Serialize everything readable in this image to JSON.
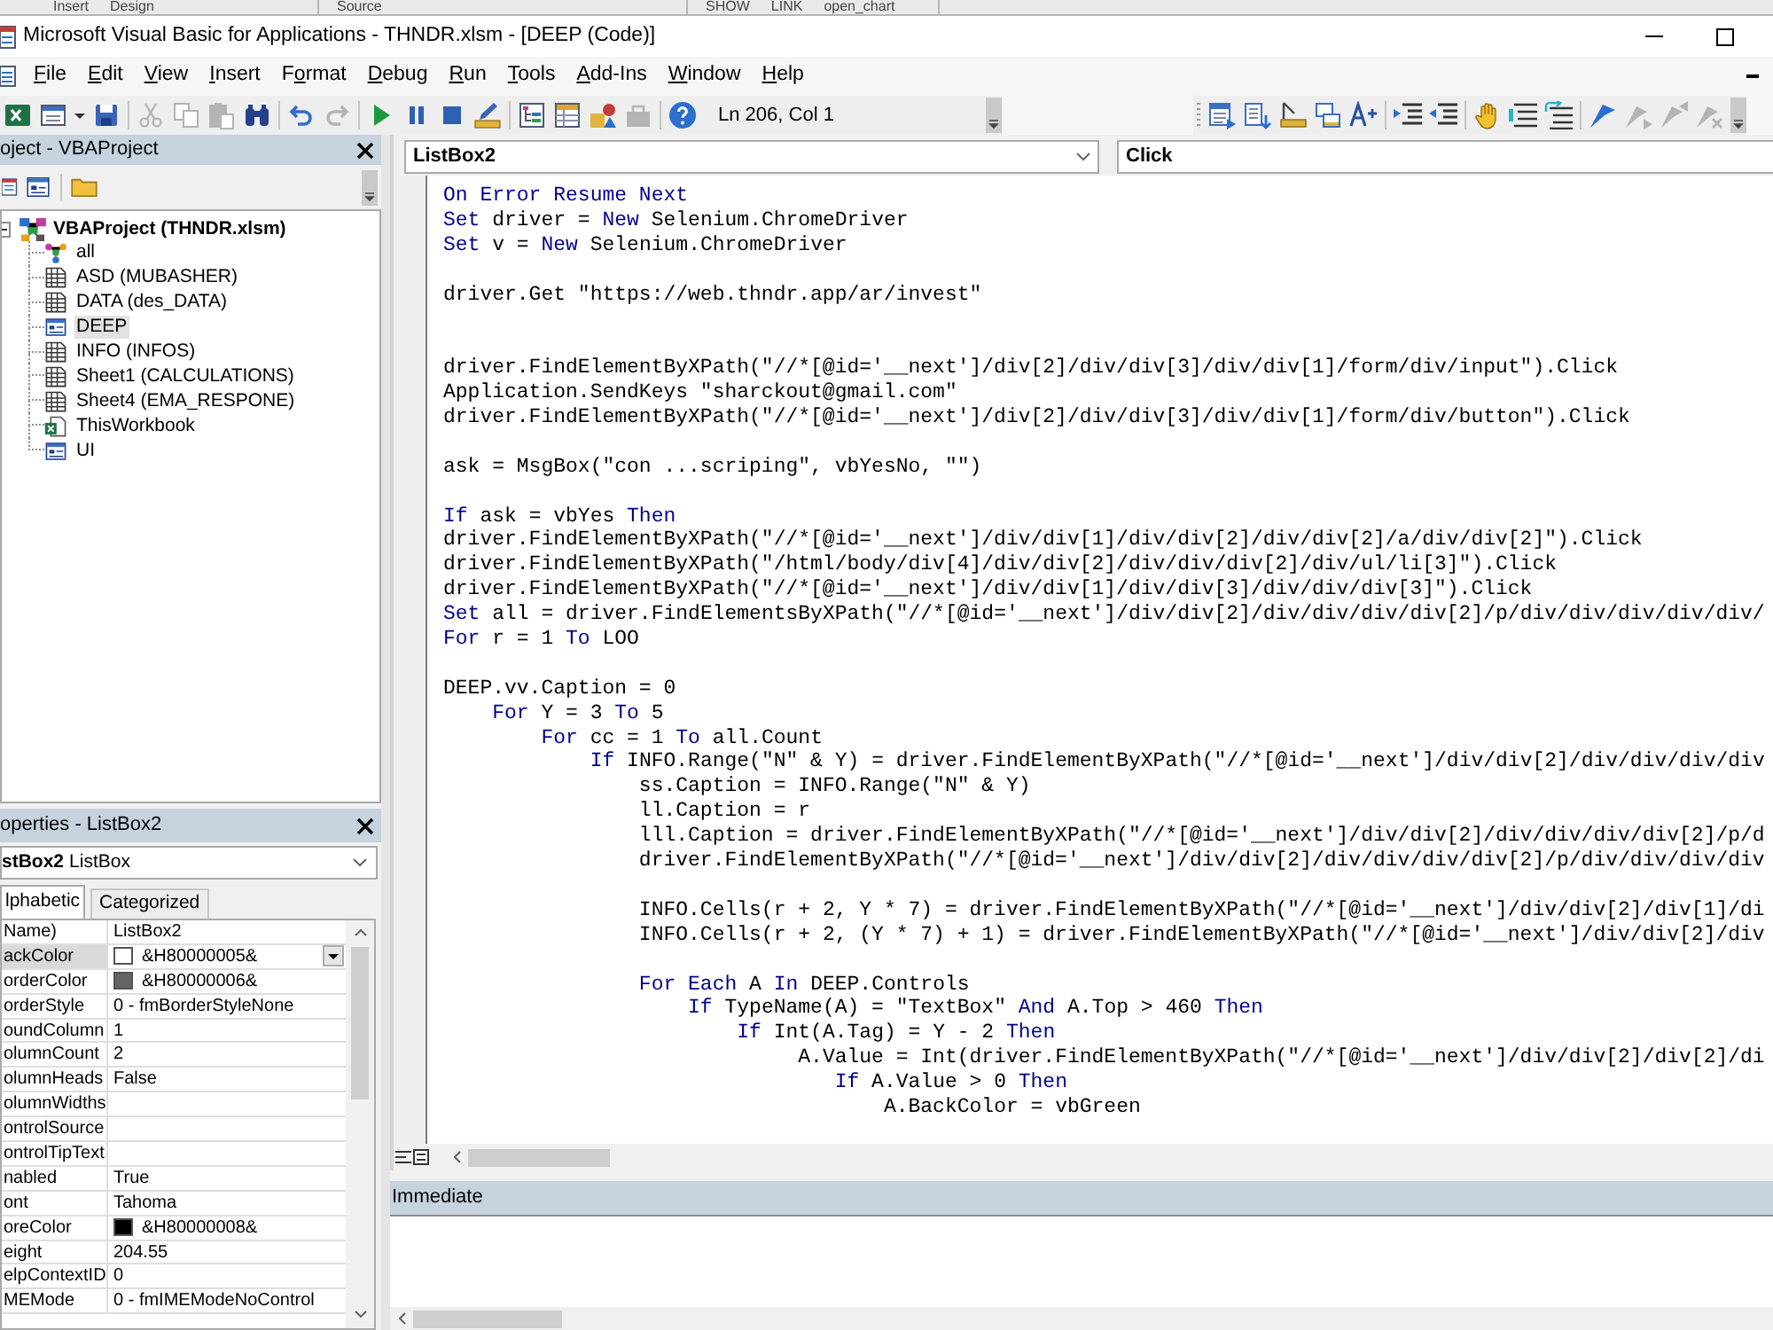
{
  "background_window": {
    "groups": [
      [
        "Insert",
        "Design"
      ],
      [
        "Source"
      ],
      [
        "SHOW",
        "LINK",
        "open_chart"
      ]
    ]
  },
  "window": {
    "title": "Microsoft Visual Basic for Applications - THNDR.xlsm - [DEEP (Code)]"
  },
  "menu": [
    {
      "parts": [
        {
          "text": "F",
          "underline": true
        },
        {
          "text": "ile",
          "underline": false
        }
      ]
    },
    {
      "parts": [
        {
          "text": "E",
          "underline": true
        },
        {
          "text": "dit",
          "underline": false
        }
      ]
    },
    {
      "parts": [
        {
          "text": "V",
          "underline": true
        },
        {
          "text": "iew",
          "underline": false
        }
      ]
    },
    {
      "parts": [
        {
          "text": "I",
          "underline": true
        },
        {
          "text": "nsert",
          "underline": false
        }
      ]
    },
    {
      "parts": [
        {
          "text": "F",
          "underline": false
        },
        {
          "text": "o",
          "underline": true
        },
        {
          "text": "rmat",
          "underline": false
        }
      ]
    },
    {
      "parts": [
        {
          "text": "D",
          "underline": true
        },
        {
          "text": "ebug",
          "underline": false
        }
      ]
    },
    {
      "parts": [
        {
          "text": "R",
          "underline": true
        },
        {
          "text": "un",
          "underline": false
        }
      ]
    },
    {
      "parts": [
        {
          "text": "T",
          "underline": true
        },
        {
          "text": "ools",
          "underline": false
        }
      ]
    },
    {
      "parts": [
        {
          "text": "A",
          "underline": true
        },
        {
          "text": "dd-Ins",
          "underline": false
        }
      ]
    },
    {
      "parts": [
        {
          "text": "W",
          "underline": true
        },
        {
          "text": "indow",
          "underline": false
        }
      ]
    },
    {
      "parts": [
        {
          "text": "H",
          "underline": true
        },
        {
          "text": "elp",
          "underline": false
        }
      ]
    }
  ],
  "standard_toolbar": {
    "groups": [
      [
        {
          "kind": "spreadsheet",
          "disabled": false
        },
        {
          "kind": "form",
          "disabled": false
        },
        {
          "kind": "dropdown",
          "disabled": false
        },
        {
          "kind": "save",
          "disabled": false
        }
      ],
      [
        {
          "kind": "cut",
          "disabled": true
        },
        {
          "kind": "copy",
          "disabled": true
        },
        {
          "kind": "paste",
          "disabled": true
        },
        {
          "kind": "find",
          "disabled": false
        }
      ],
      [
        {
          "kind": "undo",
          "disabled": false
        },
        {
          "kind": "redo",
          "disabled": true
        }
      ],
      [
        {
          "kind": "run",
          "disabled": false
        },
        {
          "kind": "pause",
          "disabled": false
        },
        {
          "kind": "stop",
          "disabled": false
        },
        {
          "kind": "design",
          "disabled": false
        }
      ],
      [
        {
          "kind": "project",
          "disabled": false
        },
        {
          "kind": "properties",
          "disabled": false
        },
        {
          "kind": "browser",
          "disabled": false
        },
        {
          "kind": "toolbox",
          "disabled": true
        }
      ],
      [
        {
          "kind": "help",
          "disabled": false
        }
      ]
    ],
    "position": "Ln 206, Col 1"
  },
  "edit_toolbar": {
    "groups": [
      [
        {
          "kind": "members",
          "disabled": false
        },
        {
          "kind": "constants",
          "disabled": false
        },
        {
          "kind": "quick_info",
          "disabled": false
        },
        {
          "kind": "parameter_info",
          "disabled": false
        },
        {
          "kind": "complete_word",
          "disabled": false
        }
      ],
      [
        {
          "kind": "indent",
          "disabled": false
        },
        {
          "kind": "outdent",
          "disabled": false
        }
      ],
      [
        {
          "kind": "breakpoint",
          "disabled": false
        },
        {
          "kind": "comment",
          "disabled": false
        },
        {
          "kind": "uncomment",
          "disabled": false
        }
      ],
      [
        {
          "kind": "bookmark",
          "disabled": false
        },
        {
          "kind": "next_bookmark",
          "disabled": true
        },
        {
          "kind": "previous_bookmark",
          "disabled": true
        },
        {
          "kind": "clear_bookmarks",
          "disabled": true
        }
      ]
    ]
  },
  "project": {
    "title": "oject - VBAProject",
    "root": {
      "label": "VBAProject (THNDR.xlsm)",
      "expanded": true,
      "children": [
        {
          "label": "all",
          "kind": "module",
          "selected": false
        },
        {
          "label": "ASD (MUBASHER)",
          "kind": "sheet",
          "selected": false
        },
        {
          "label": "DATA (des_DATA)",
          "kind": "sheet",
          "selected": false
        },
        {
          "label": "DEEP",
          "kind": "form",
          "selected": true
        },
        {
          "label": "INFO (INFOS)",
          "kind": "sheet",
          "selected": false
        },
        {
          "label": "Sheet1 (CALCULATIONS)",
          "kind": "sheet",
          "selected": false
        },
        {
          "label": "Sheet4 (EMA_RESPONE)",
          "kind": "sheet",
          "selected": false
        },
        {
          "label": "ThisWorkbook",
          "kind": "workbook",
          "selected": false
        },
        {
          "label": "UI",
          "kind": "form",
          "selected": false
        }
      ]
    }
  },
  "properties": {
    "title": "operties - ListBox2",
    "object": {
      "name": "stBox2",
      "type": "ListBox"
    },
    "tabs": [
      {
        "label": "lphabetic",
        "selected": true
      },
      {
        "label": "Categorized",
        "selected": false
      }
    ],
    "rows": [
      {
        "name": "Name)",
        "value": "ListBox2",
        "selected": false
      },
      {
        "name": "ackColor",
        "value": "&H80000005&",
        "color": "#ffffff",
        "selected": true
      },
      {
        "name": "orderColor",
        "value": "&H80000006&",
        "color": "#646464",
        "selected": false
      },
      {
        "name": "orderStyle",
        "value": "0 - fmBorderStyleNone",
        "selected": false
      },
      {
        "name": "oundColumn",
        "value": "1",
        "selected": false
      },
      {
        "name": "olumnCount",
        "value": "2",
        "selected": false
      },
      {
        "name": "olumnHeads",
        "value": "False",
        "selected": false
      },
      {
        "name": "olumnWidths",
        "selected": false
      },
      {
        "name": "ontrolSource",
        "selected": false
      },
      {
        "name": "ontrolTipText",
        "selected": false
      },
      {
        "name": "nabled",
        "value": "True",
        "selected": false
      },
      {
        "name": "ont",
        "value": "Tahoma",
        "selected": false
      },
      {
        "name": "oreColor",
        "value": "&H80000008&",
        "color": "#000000",
        "selected": false
      },
      {
        "name": "eight",
        "value": "204.55",
        "selected": false
      },
      {
        "name": "elpContextID",
        "value": "0",
        "selected": false
      },
      {
        "name": "MEMode",
        "value": "0 - fmIMEModeNoControl",
        "selected": false
      }
    ]
  },
  "code_window": {
    "object": "ListBox2",
    "procedure": "Click",
    "lines": [
      {
        "kind": "code",
        "segments": [
          {
            "kind": "keyword",
            "text": "On Error Resume Next"
          }
        ]
      },
      {
        "kind": "code",
        "segments": [
          {
            "kind": "keyword",
            "text": "Set"
          },
          {
            "kind": "plain",
            "text": " driver = "
          },
          {
            "kind": "keyword",
            "text": "New"
          },
          {
            "kind": "plain",
            "text": " Selenium.ChromeDriver"
          }
        ]
      },
      {
        "kind": "code",
        "segments": [
          {
            "kind": "keyword",
            "text": "Set"
          },
          {
            "kind": "plain",
            "text": " v = "
          },
          {
            "kind": "keyword",
            "text": "New"
          },
          {
            "kind": "plain",
            "text": " Selenium.ChromeDriver"
          }
        ]
      },
      {
        "kind": "blank"
      },
      {
        "kind": "code",
        "segments": [
          {
            "kind": "plain",
            "text": "driver.Get \"https://web.thndr.app/ar/invest\""
          }
        ]
      },
      {
        "kind": "blank"
      },
      {
        "kind": "blank"
      },
      {
        "kind": "code",
        "segments": [
          {
            "kind": "plain",
            "text": "driver.FindElementByXPath(\"//*[@id='__next']/div[2]/div/div[3]/div/div[1]/form/div/input\").Click"
          }
        ]
      },
      {
        "kind": "code",
        "segments": [
          {
            "kind": "plain",
            "text": "Application.SendKeys \"sharckout@gmail.com\""
          }
        ]
      },
      {
        "kind": "code",
        "segments": [
          {
            "kind": "plain",
            "text": "driver.FindElementByXPath(\"//*[@id='__next']/div[2]/div/div[3]/div/div[1]/form/div/button\").Click"
          }
        ]
      },
      {
        "kind": "blank"
      },
      {
        "kind": "code",
        "segments": [
          {
            "kind": "plain",
            "text": "ask = MsgBox(\"con ...scriping\", vbYesNo, \"\")"
          }
        ]
      },
      {
        "kind": "blank"
      },
      {
        "kind": "code",
        "segments": [
          {
            "kind": "keyword",
            "text": "If"
          },
          {
            "kind": "plain",
            "text": " ask = vbYes "
          },
          {
            "kind": "keyword",
            "text": "Then"
          }
        ]
      },
      {
        "kind": "code",
        "segments": [
          {
            "kind": "plain",
            "text": "driver.FindElementByXPath(\"//*[@id='__next']/div/div[1]/div/div[2]/div/div[2]/a/div/div[2]\").Click"
          }
        ]
      },
      {
        "kind": "code",
        "segments": [
          {
            "kind": "plain",
            "text": "driver.FindElementByXPath(\"/html/body/div[4]/div/div[2]/div/div/div[2]/div/ul/li[3]\").Click"
          }
        ]
      },
      {
        "kind": "code",
        "segments": [
          {
            "kind": "plain",
            "text": "driver.FindElementByXPath(\"//*[@id='__next']/div/div[1]/div/div[3]/div/div/div[3]\").Click"
          }
        ]
      },
      {
        "kind": "code",
        "segments": [
          {
            "kind": "keyword",
            "text": "Set"
          },
          {
            "kind": "plain",
            "text": " all = driver.FindElementsByXPath(\"//*[@id='__next']/div/div[2]/div/div/div/div[2]/p/div/div/div/div/div/"
          }
        ]
      },
      {
        "kind": "code",
        "segments": [
          {
            "kind": "keyword",
            "text": "For"
          },
          {
            "kind": "plain",
            "text": " r = 1 "
          },
          {
            "kind": "keyword",
            "text": "To"
          },
          {
            "kind": "plain",
            "text": " LOO"
          }
        ]
      },
      {
        "kind": "blank"
      },
      {
        "kind": "code",
        "segments": [
          {
            "kind": "plain",
            "text": "DEEP.vv.Caption = 0"
          }
        ]
      },
      {
        "kind": "code",
        "segments": [
          {
            "kind": "keyword",
            "text": "    For"
          },
          {
            "kind": "plain",
            "text": " Y = 3 "
          },
          {
            "kind": "keyword",
            "text": "To"
          },
          {
            "kind": "plain",
            "text": " 5"
          }
        ]
      },
      {
        "kind": "code",
        "segments": [
          {
            "kind": "keyword",
            "text": "        For"
          },
          {
            "kind": "plain",
            "text": " cc = 1 "
          },
          {
            "kind": "keyword",
            "text": "To"
          },
          {
            "kind": "plain",
            "text": " all.Count"
          }
        ]
      },
      {
        "kind": "code",
        "segments": [
          {
            "kind": "keyword",
            "text": "            If"
          },
          {
            "kind": "plain",
            "text": " INFO.Range(\"N\" & Y) = driver.FindElementByXPath(\"//*[@id='__next']/div/div[2]/div/div/div/div"
          }
        ]
      },
      {
        "kind": "code",
        "segments": [
          {
            "kind": "plain",
            "text": "                ss.Caption = INFO.Range(\"N\" & Y)"
          }
        ]
      },
      {
        "kind": "code",
        "segments": [
          {
            "kind": "plain",
            "text": "                ll.Caption = r"
          }
        ]
      },
      {
        "kind": "code",
        "segments": [
          {
            "kind": "plain",
            "text": "                lll.Caption = driver.FindElementByXPath(\"//*[@id='__next']/div/div[2]/div/div/div/div[2]/p/d"
          }
        ]
      },
      {
        "kind": "code",
        "segments": [
          {
            "kind": "plain",
            "text": "                driver.FindElementByXPath(\"//*[@id='__next']/div/div[2]/div/div/div/div[2]/p/div/div/div/div"
          }
        ]
      },
      {
        "kind": "blank"
      },
      {
        "kind": "code",
        "segments": [
          {
            "kind": "plain",
            "text": "                INFO.Cells(r + 2, Y * 7) = driver.FindElementByXPath(\"//*[@id='__next']/div/div[2]/div[1]/di"
          }
        ]
      },
      {
        "kind": "code",
        "segments": [
          {
            "kind": "plain",
            "text": "                INFO.Cells(r + 2, (Y * 7) + 1) = driver.FindElementByXPath(\"//*[@id='__next']/div/div[2]/div"
          }
        ]
      },
      {
        "kind": "blank"
      },
      {
        "kind": "code",
        "segments": [
          {
            "kind": "keyword",
            "text": "                For Each"
          },
          {
            "kind": "plain",
            "text": " A "
          },
          {
            "kind": "keyword",
            "text": "In"
          },
          {
            "kind": "plain",
            "text": " DEEP.Controls"
          }
        ]
      },
      {
        "kind": "code",
        "segments": [
          {
            "kind": "keyword",
            "text": "                    If"
          },
          {
            "kind": "plain",
            "text": " TypeName(A) = \"TextBox\" "
          },
          {
            "kind": "keyword",
            "text": "And"
          },
          {
            "kind": "plain",
            "text": " A.Top > 460 "
          },
          {
            "kind": "keyword",
            "text": "Then"
          }
        ]
      },
      {
        "kind": "code",
        "segments": [
          {
            "kind": "keyword",
            "text": "                        If"
          },
          {
            "kind": "plain",
            "text": " Int(A.Tag) = Y - 2 "
          },
          {
            "kind": "keyword",
            "text": "Then"
          }
        ]
      },
      {
        "kind": "code",
        "segments": [
          {
            "kind": "plain",
            "text": "                             A.Value = Int(driver.FindElementByXPath(\"//*[@id='__next']/div/div[2]/div[2]/di"
          }
        ]
      },
      {
        "kind": "code",
        "segments": [
          {
            "kind": "keyword",
            "text": "                                If"
          },
          {
            "kind": "plain",
            "text": " A.Value > 0 "
          },
          {
            "kind": "keyword",
            "text": "Then"
          }
        ]
      },
      {
        "kind": "code",
        "segments": [
          {
            "kind": "plain",
            "text": "                                    A.BackColor = vbGreen"
          }
        ]
      }
    ]
  },
  "immediate": {
    "title": "Immediate"
  }
}
